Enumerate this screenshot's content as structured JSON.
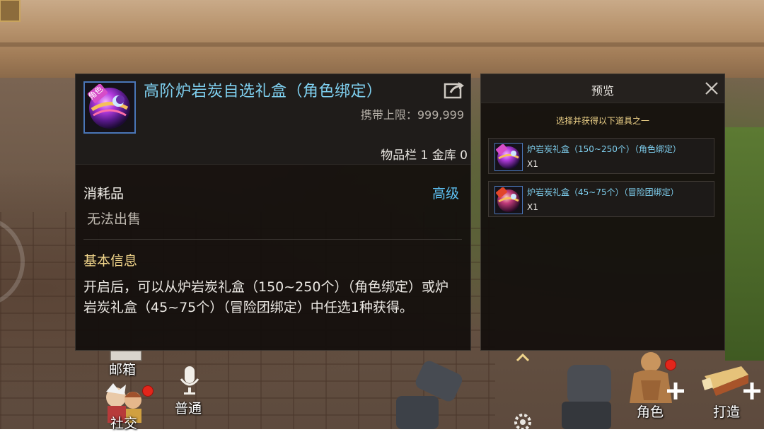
{
  "item": {
    "title": "高阶炉岩炭自选礼盒（角色绑定）",
    "icon_badge": "角色",
    "carry_limit": "携带上限：999,999",
    "inventory_counts": "物品栏 1 金库 0",
    "category": "消耗品",
    "grade": "高级",
    "sell_status": "无法出售",
    "section_title": "基本信息",
    "description": "开启后，可以从炉岩炭礼盒（150~250个）（角色绑定）或炉岩炭礼盒（45~75个）（冒险团绑定）中任选1种获得。"
  },
  "preview": {
    "title": "预览",
    "subtitle": "选择并获得以下道具之一",
    "options": [
      {
        "name": "炉岩炭礼盒（150~250个）（角色绑定）",
        "qty": "X1",
        "badge": "角色"
      },
      {
        "name": "炉岩炭礼盒（45~75个）（冒险团绑定）",
        "qty": "X1",
        "badge": "冒险"
      }
    ]
  },
  "hud": {
    "mailbox": "邮箱",
    "social": "社交",
    "channel": "普通",
    "character": "角色",
    "craft": "打造"
  },
  "colors": {
    "title_blue": "#7fd0f0",
    "grade_blue": "#5dc0f2",
    "section_gold": "#f0d48a",
    "notification_red": "#e2261b"
  },
  "icons": [
    "share-icon",
    "close-icon",
    "microphone-icon",
    "gear-icon",
    "chevron-up-icon",
    "plus-icon"
  ]
}
